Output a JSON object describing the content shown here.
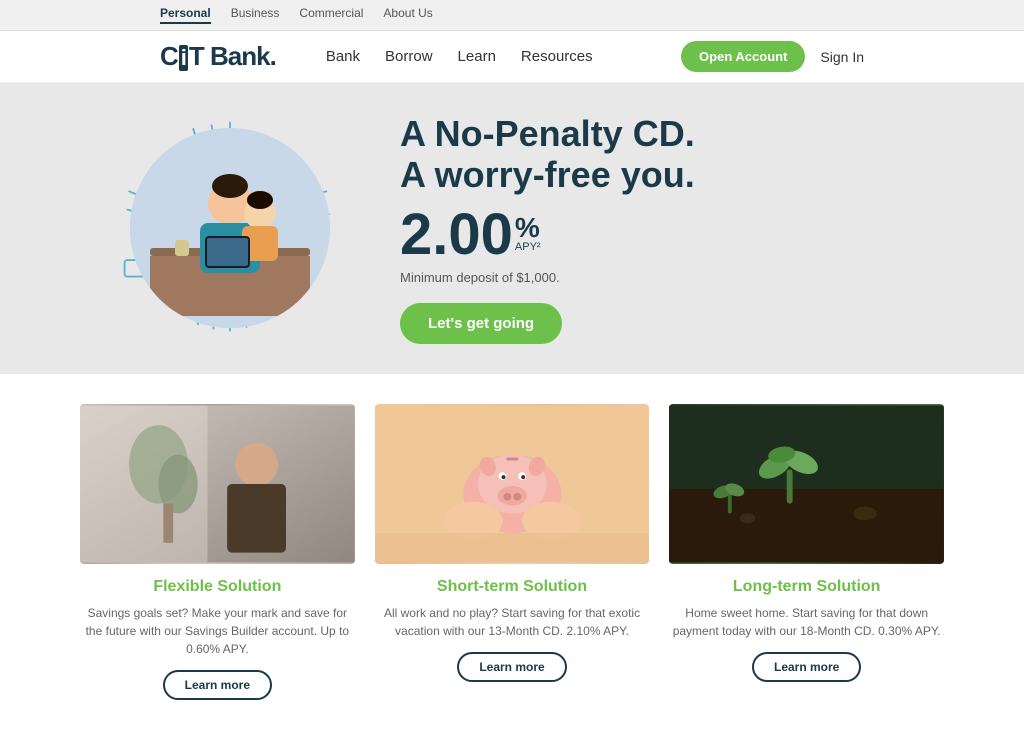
{
  "top_nav": {
    "items": [
      {
        "label": "Personal",
        "active": true
      },
      {
        "label": "Business",
        "active": false
      },
      {
        "label": "Commercial",
        "active": false
      },
      {
        "label": "About Us",
        "active": false
      }
    ]
  },
  "main_nav": {
    "logo_cit": "CiT",
    "logo_bank": "Bank.",
    "links": [
      {
        "label": "Bank"
      },
      {
        "label": "Borrow"
      },
      {
        "label": "Learn"
      },
      {
        "label": "Resources"
      }
    ],
    "open_account": "Open Account",
    "sign_in": "Sign In"
  },
  "hero": {
    "heading_line1": "A No-Penalty CD.",
    "heading_line2": "A worry-free you.",
    "rate_number": "2.00",
    "rate_percent": "%",
    "rate_apy": "APY²",
    "min_deposit": "Minimum deposit of $1,000.",
    "cta_label": "Let's get going"
  },
  "cards": [
    {
      "title": "Flexible Solution",
      "desc": "Savings goals set? Make your mark and save for the future with our Savings Builder account. Up to 0.60% APY.",
      "btn_label": "Learn more"
    },
    {
      "title": "Short-term Solution",
      "desc": "All work and no play? Start saving for that exotic vacation with our 13-Month CD. 2.10% APY.",
      "btn_label": "Learn more"
    },
    {
      "title": "Long-term Solution",
      "desc": "Home sweet home. Start saving for that down payment today with our 18-Month CD. 0.30% APY.",
      "btn_label": "Learn more"
    }
  ]
}
